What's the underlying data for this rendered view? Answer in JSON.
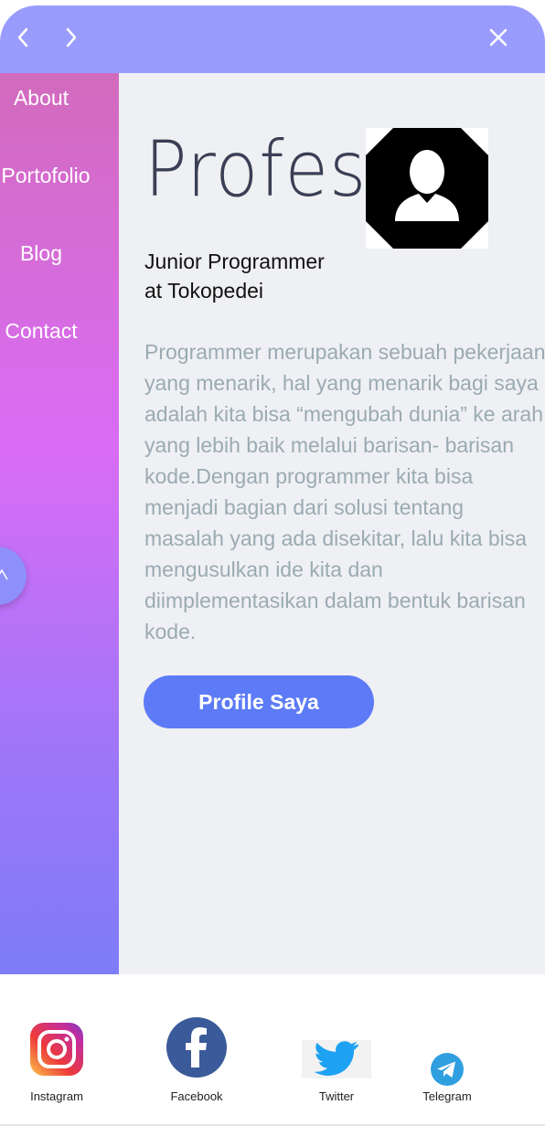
{
  "toolbar": {
    "back_icon": "chevron-left-icon",
    "forward_icon": "chevron-right-icon",
    "close_icon": "close-icon",
    "color": "#9a9cfd"
  },
  "sidebar": {
    "items": [
      {
        "label": "About"
      },
      {
        "label": "Portofolio"
      },
      {
        "label": "Blog"
      },
      {
        "label": "Contact"
      }
    ],
    "scroll_up_icon": "arrow-up-icon"
  },
  "main": {
    "headline": "Profesi",
    "avatar_icon": "user-avatar-icon",
    "job_title": "Junior Programmer\nat Tokopedei",
    "description": "Programmer merupakan sebuah pekerjaan yang menarik, hal yang menarik bagi saya adalah kita bisa “mengubah dunia” ke arah yang lebih baik melalui barisan- barisan kode.Dengan programmer kita bisa menjadi bagian dari solusi tentang masalah yang ada disekitar, lalu kita bisa mengusulkan ide kita dan diimplementasikan dalam bentuk barisan kode.",
    "button_label": "Profile Saya",
    "accent": "#5d7bf6"
  },
  "footer": {
    "links": [
      {
        "label": "Instagram",
        "icon": "instagram-icon"
      },
      {
        "label": "Facebook",
        "icon": "facebook-icon"
      },
      {
        "label": "Twitter",
        "icon": "twitter-icon"
      },
      {
        "label": "Telegram",
        "icon": "telegram-icon"
      }
    ]
  }
}
